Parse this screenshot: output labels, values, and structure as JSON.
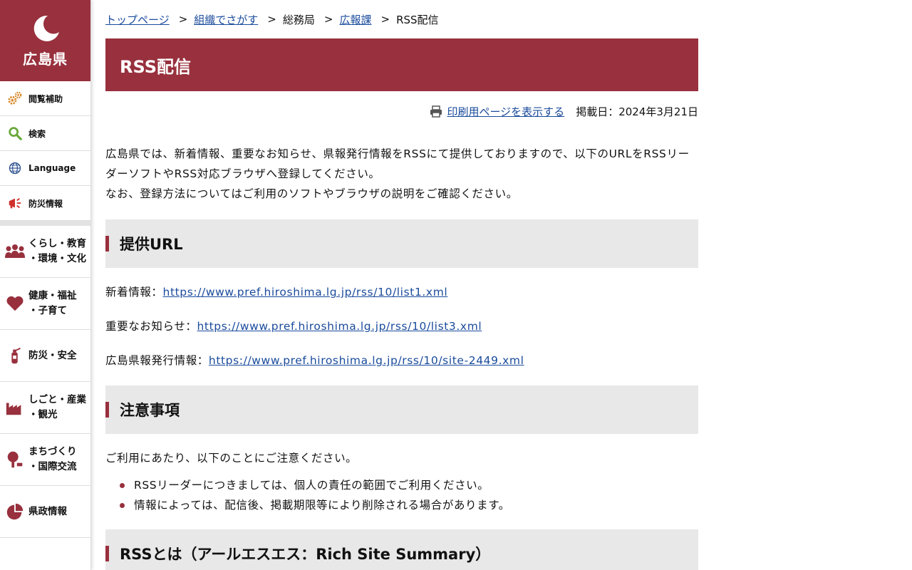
{
  "sidebar": {
    "logo_text": "広島県",
    "utility": [
      {
        "label": "閲覧補助",
        "icon": "gears-icon"
      },
      {
        "label": "検索",
        "icon": "search-icon"
      },
      {
        "label": "Language",
        "icon": "globe-icon"
      },
      {
        "label": "防災情報",
        "icon": "megaphone-icon"
      }
    ],
    "categories": [
      {
        "line1": "くらし・教育",
        "line2": "・環境・文化",
        "icon": "people-icon"
      },
      {
        "line1": "健康・福祉",
        "line2": "・子育て",
        "icon": "heart-icon"
      },
      {
        "line1": "防災・安全",
        "line2": "",
        "icon": "extinguisher-icon"
      },
      {
        "line1": "しごと・産業",
        "line2": "・観光",
        "icon": "factory-icon"
      },
      {
        "line1": "まちづくり",
        "line2": "・国際交流",
        "icon": "tree-icon"
      },
      {
        "line1": "県政情報",
        "line2": "",
        "icon": "pie-chart-icon"
      }
    ]
  },
  "breadcrumb": {
    "items": [
      "トップページ",
      "組織でさがす",
      "総務局",
      "広報課",
      "RSS配信"
    ],
    "separator": ">"
  },
  "page": {
    "title": "RSS配信",
    "print_label": "印刷用ページを表示する",
    "published": "掲載日：2024年3月21日",
    "intro_line1": "広島県では、新着情報、重要なお知らせ、県報発行情報をRSSにて提供しておりますので、以下のURLをRSSリーダーソフトやRSS対応ブラウザへ登録してください。",
    "intro_line2": "なお、登録方法についてはご利用のソフトやブラウザの説明をご確認ください。"
  },
  "section_urls": {
    "heading": "提供URL",
    "links": [
      {
        "label": "新着情報：",
        "url": "https://www.pref.hiroshima.lg.jp/rss/10/list1.xml"
      },
      {
        "label": "重要なお知らせ：",
        "url": "https://www.pref.hiroshima.lg.jp/rss/10/list3.xml"
      },
      {
        "label": "広島県報発行情報：",
        "url": "https://www.pref.hiroshima.lg.jp/rss/10/site-2449.xml"
      }
    ]
  },
  "section_notes": {
    "heading": "注意事項",
    "lead": "ご利用にあたり、以下のことにご注意ください。",
    "bullets": [
      "RSSリーダーにつきましては、個人の責任の範囲でご利用ください。",
      "情報によっては、配信後、掲載期限等により削除される場合があります。"
    ]
  },
  "section_about": {
    "heading": "RSSとは（アールエスエス：Rich Site Summary）"
  },
  "colors": {
    "brand": "#98303d",
    "link": "#1a4b9c",
    "section_bg": "#e8e8e8"
  }
}
